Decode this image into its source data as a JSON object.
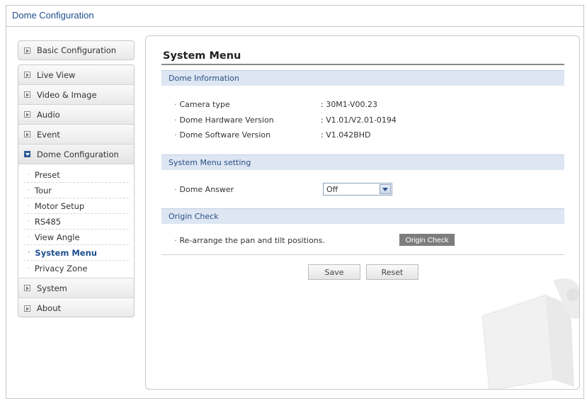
{
  "window": {
    "title": "Dome Configuration"
  },
  "sidebar": {
    "basic": "Basic Configuration",
    "items": [
      {
        "label": "Live View"
      },
      {
        "label": "Video & Image"
      },
      {
        "label": "Audio"
      },
      {
        "label": "Event"
      },
      {
        "label": "Dome Configuration"
      }
    ],
    "sub_items": [
      {
        "label": "Preset"
      },
      {
        "label": "Tour"
      },
      {
        "label": "Motor Setup"
      },
      {
        "label": "RS485"
      },
      {
        "label": "View Angle"
      },
      {
        "label": "System Menu"
      },
      {
        "label": "Privacy Zone"
      }
    ],
    "bottom_items": [
      {
        "label": "System"
      },
      {
        "label": "About"
      }
    ]
  },
  "main": {
    "title": "System Menu",
    "dome_info": {
      "heading": "Dome Information",
      "rows": [
        {
          "label": "Camera type",
          "value": ": 30M1-V00.23"
        },
        {
          "label": "Dome Hardware Version",
          "value": ": V1.01/V2.01-0194"
        },
        {
          "label": "Dome Software Version",
          "value": ": V1.042BHD"
        }
      ]
    },
    "menu_setting": {
      "heading": "System Menu setting",
      "dome_answer_label": "Dome Answer",
      "dome_answer_value": "Off"
    },
    "origin": {
      "heading": "Origin Check",
      "description": "Re-arrange the pan and tilt positions.",
      "button": "Origin Check"
    },
    "save": "Save",
    "reset": "Reset"
  },
  "bullet": "·"
}
